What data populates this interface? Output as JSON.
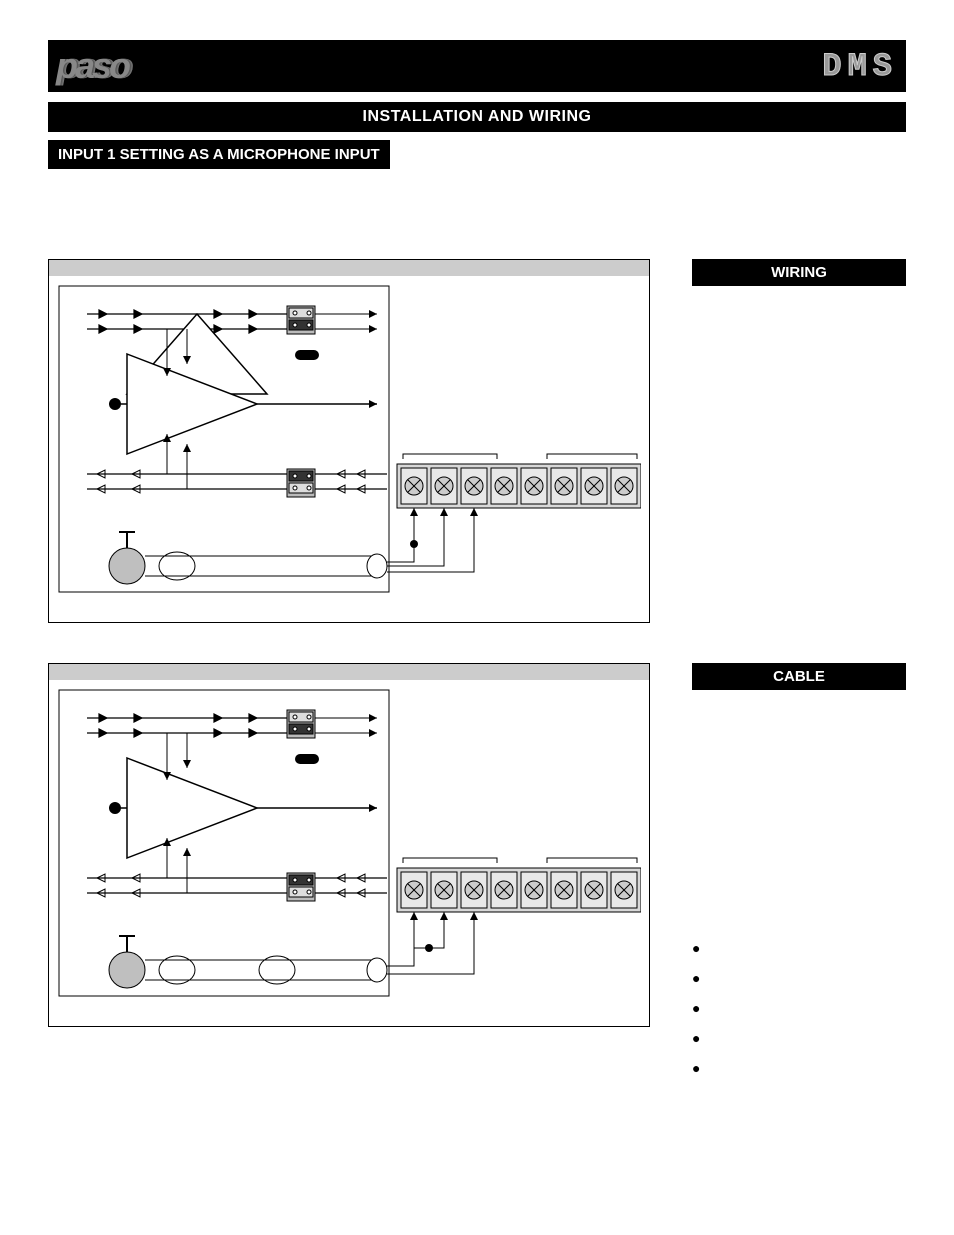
{
  "brand_left": "paso",
  "brand_right": "DMS",
  "section_title": "INSTALLATION AND WIRING",
  "subsection_title": "INPUT 1 SETTING AS A MICROPHONE INPUT",
  "wiring": {
    "header": "WIRING"
  },
  "cable": {
    "header": "CABLE"
  },
  "bullets": [
    "",
    "",
    "",
    "",
    ""
  ]
}
